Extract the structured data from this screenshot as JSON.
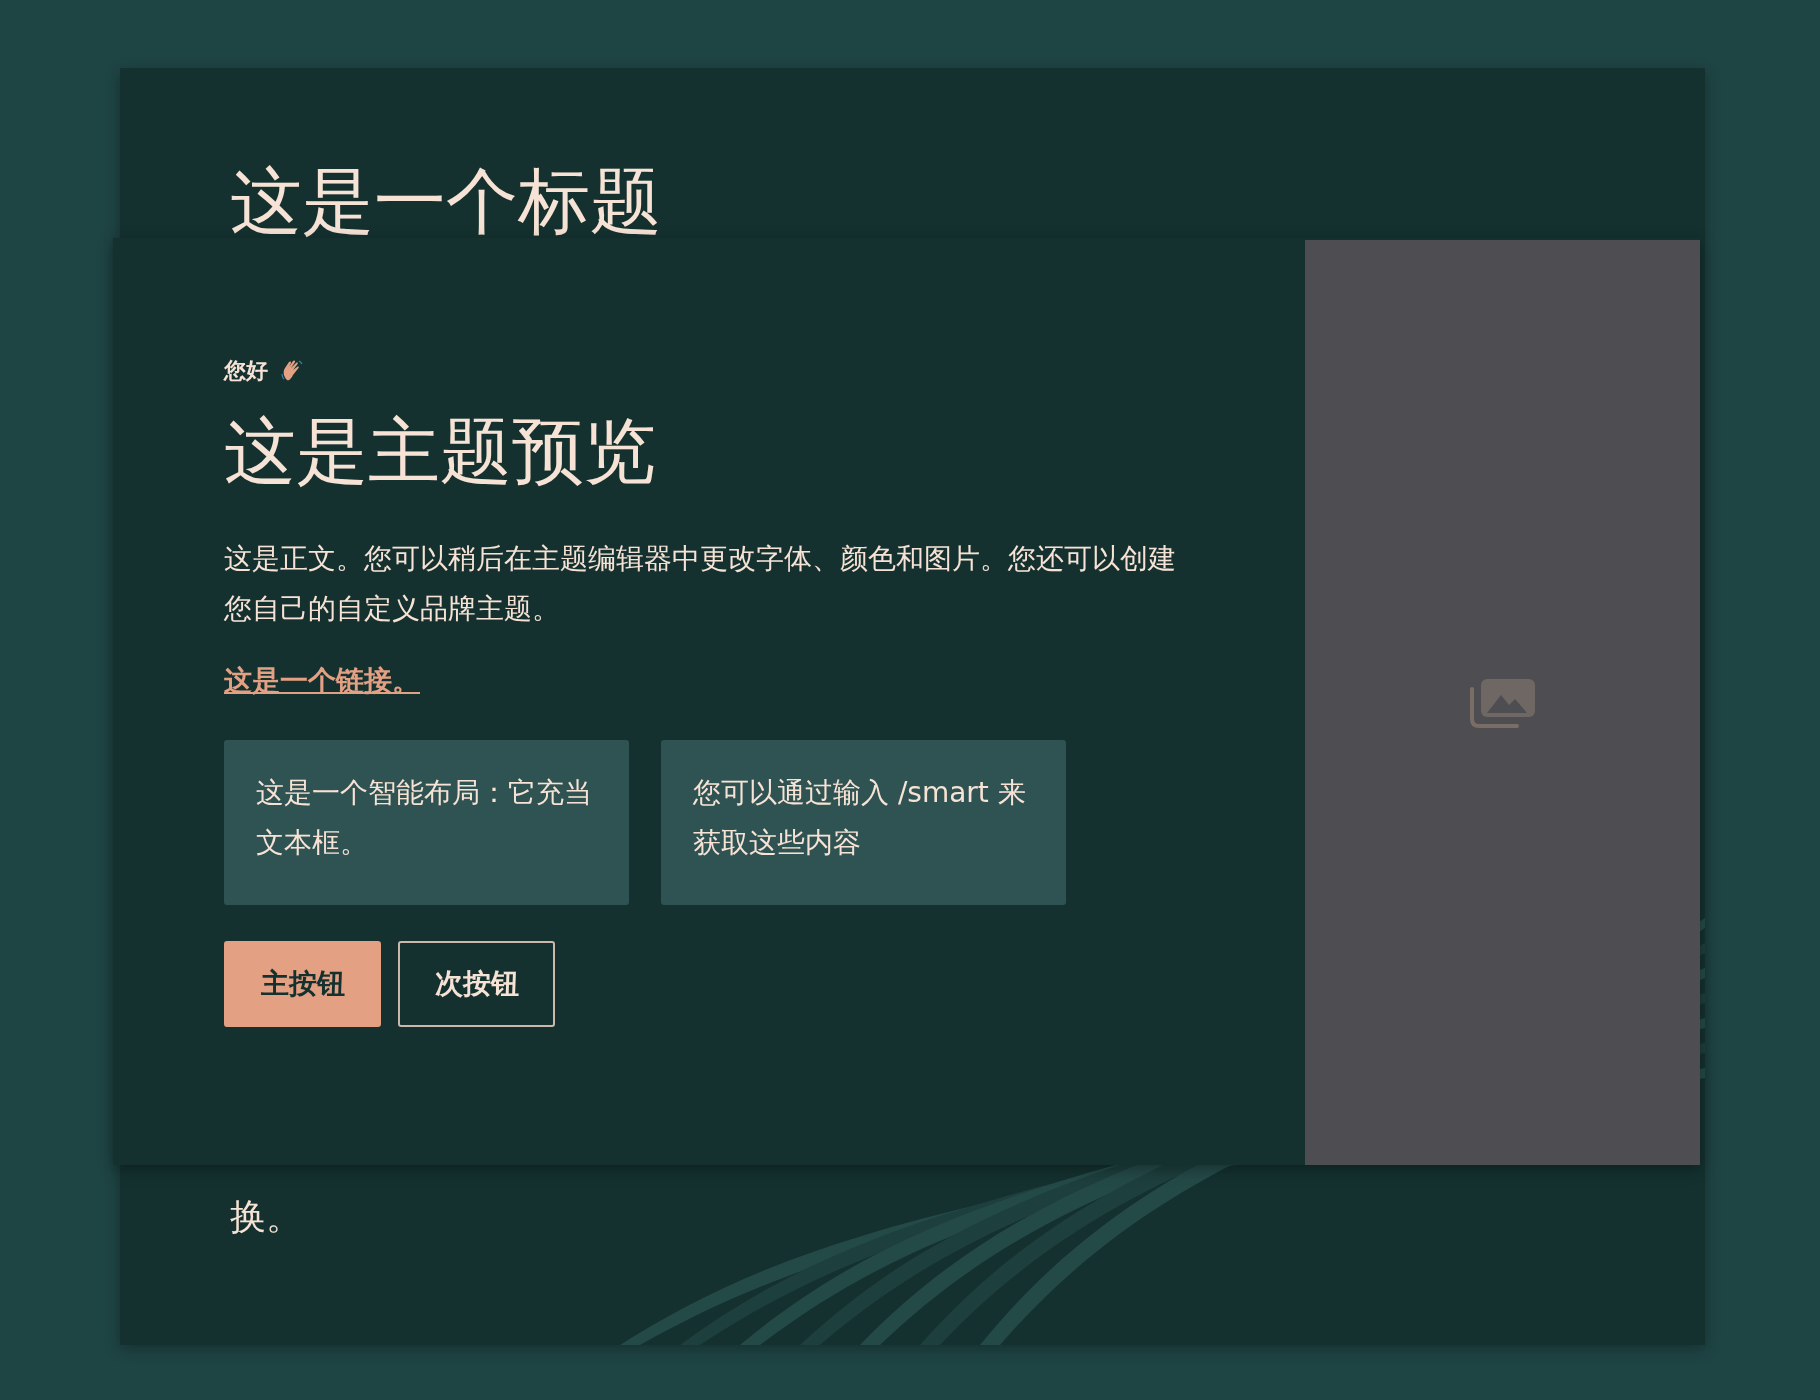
{
  "back_slide": {
    "title": "这是一个标题",
    "body_tail": "换。"
  },
  "front_slide": {
    "greeting": "您好",
    "heading": "这是主题预览",
    "body": "这是正文。您可以稍后在主题编辑器中更改字体、颜色和图片。您还可以创建您自己的自定义品牌主题。",
    "link": "这是一个链接。",
    "smart_boxes": [
      "这是一个智能布局：它充当文本框。",
      "您可以通过输入 /smart 来获取这些内容"
    ],
    "buttons": [
      {
        "label": "主按钮",
        "kind": "primary"
      },
      {
        "label": "次按钮",
        "kind": "secondary"
      }
    ],
    "image": {
      "kind": "placeholder"
    }
  }
}
